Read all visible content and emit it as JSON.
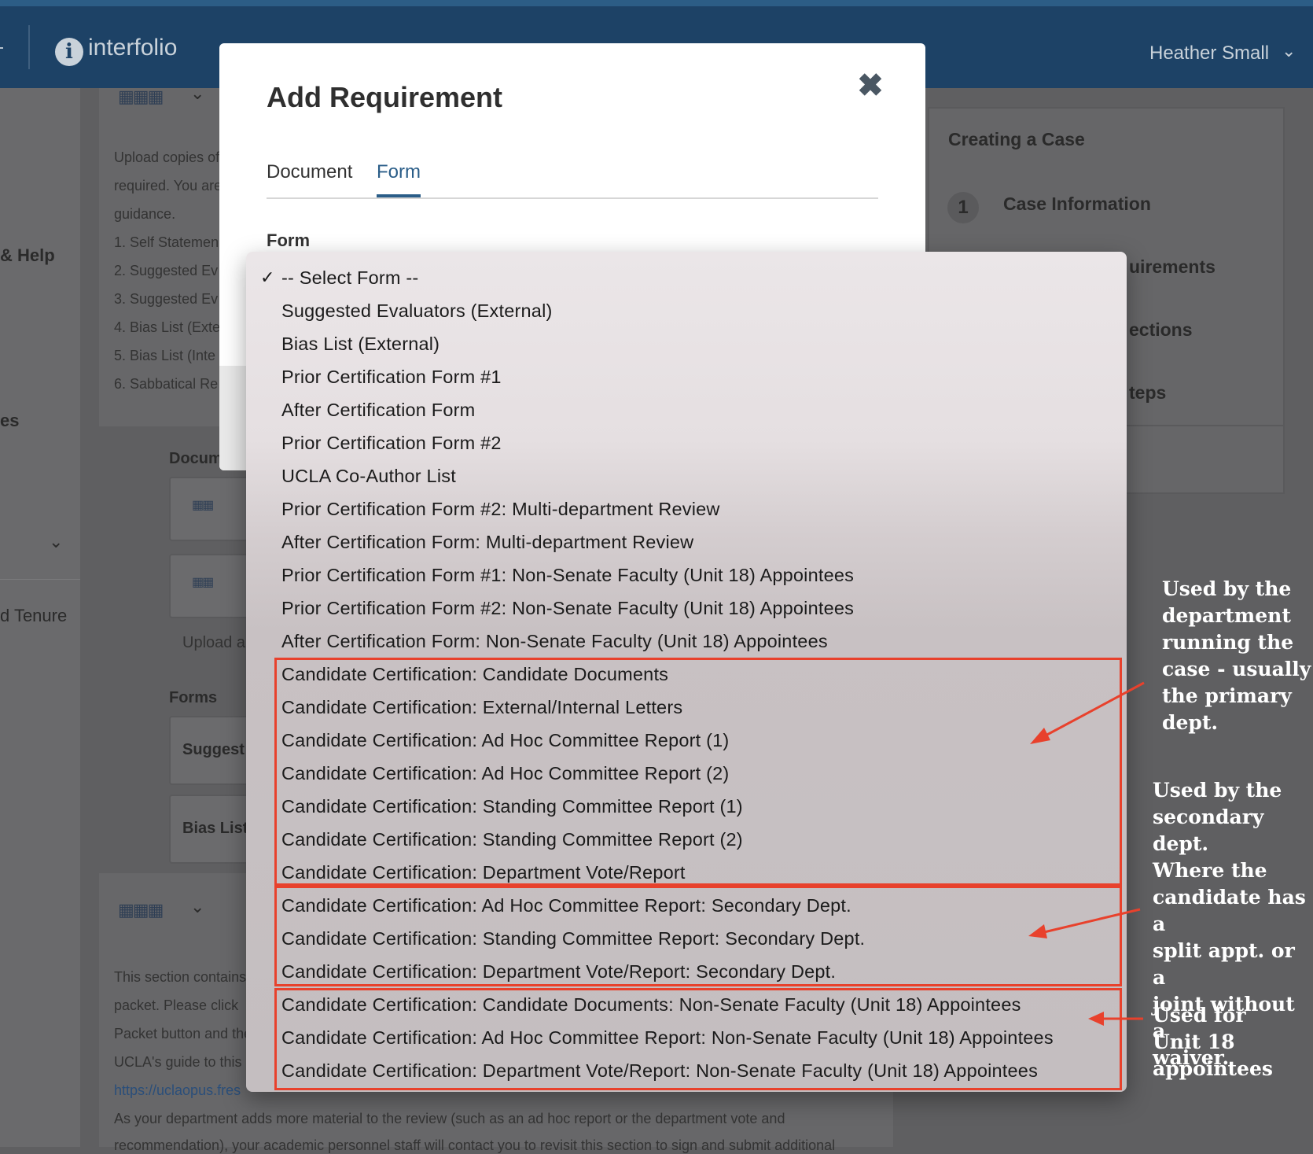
{
  "header": {
    "logo_letter": "i",
    "logo_text": "interfolio",
    "user_name": "Heather Small",
    "user_chevron": "chevron-down-icon"
  },
  "background": {
    "left_nav": [
      "& Help",
      "es",
      "d Tenure"
    ],
    "main_text_lines": [
      "Upload copies of",
      "required. You are",
      "guidance.",
      "1.  Self Statemen",
      "2.  Suggested Ev",
      "3.  Suggested Ev",
      "4.  Bias List (Exte",
      "5.  Bias List (Inte",
      "6.  Sabbatical Re"
    ],
    "docu_label": "Docum",
    "upload_label": "Upload a",
    "forms_label": "Forms",
    "suggest_label": "Suggest",
    "bias_label": "Bias List",
    "section_text_lines": [
      "This section contains",
      "packet.  Please click",
      "Packet button and the",
      "UCLA's guide to this s"
    ],
    "link_text": "https://uclaopus.fres",
    "bottom_line_1": "As your department adds more material to the review (such as an ad hoc report or the department vote and",
    "bottom_line_2": "recommendation), your academic personnel staff will contact you to revisit this section to sign and submit additional",
    "right_panel_title": "Creating a Case",
    "step_1_number": "1",
    "step_1_label": "Case Information",
    "step_2_label": "uirements",
    "step_3_label": "ections",
    "step_4_label": "teps"
  },
  "modal": {
    "title": "Add Requirement",
    "close_icon": "close-icon",
    "tabs": [
      {
        "label": "Document",
        "active": false
      },
      {
        "label": "Form",
        "active": true
      }
    ],
    "field_label": "Form"
  },
  "dropdown": {
    "selected_index": 0,
    "options": [
      "-- Select Form --",
      "Suggested Evaluators (External)",
      "Bias List (External)",
      "Prior Certification Form #1",
      "After Certification Form",
      "Prior Certification Form #2",
      "UCLA Co-Author List",
      "Prior Certification Form #2: Multi-department Review",
      "After Certification Form: Multi-department Review",
      "Prior Certification Form #1: Non-Senate Faculty (Unit 18) Appointees",
      "Prior Certification Form #2: Non-Senate Faculty (Unit 18) Appointees",
      "After Certification Form: Non-Senate Faculty (Unit 18) Appointees",
      "Candidate Certification: Candidate Documents",
      "Candidate Certification: External/Internal Letters",
      "Candidate Certification: Ad Hoc Committee Report (1)",
      "Candidate Certification: Ad Hoc Committee Report (2)",
      "Candidate Certification: Standing Committee Report (1)",
      "Candidate Certification: Standing Committee Report (2)",
      "Candidate Certification: Department Vote/Report",
      "Candidate Certification: Ad Hoc Committee Report: Secondary Dept.",
      "Candidate Certification: Standing Committee Report: Secondary Dept.",
      "Candidate Certification: Department Vote/Report: Secondary Dept.",
      "Candidate Certification: Candidate Documents: Non-Senate Faculty (Unit 18) Appointees",
      "Candidate Certification: Ad Hoc Committee Report: Non-Senate Faculty (Unit 18) Appointees",
      "Candidate Certification: Department Vote/Report: Non-Senate Faculty (Unit 18) Appointees"
    ]
  },
  "annotations": {
    "primary": [
      "Used by the",
      "department",
      "running the",
      "case - usually",
      "the primary",
      "dept."
    ],
    "secondary": [
      "Used by the",
      "secondary dept.",
      "Where the",
      "candidate has a",
      "split appt. or a",
      "joint without a",
      "waiver."
    ],
    "unit18": [
      "Used for",
      "Unit 18",
      "appointees"
    ],
    "color": "#e8412c"
  }
}
